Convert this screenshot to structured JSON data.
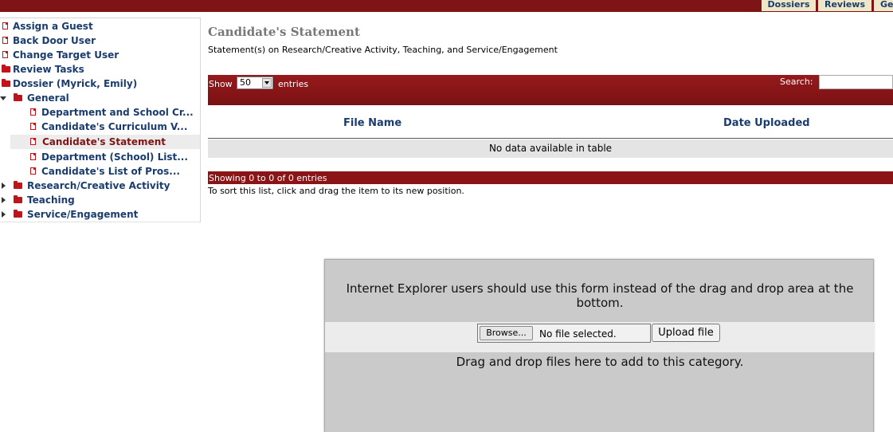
{
  "top_tabs": [
    {
      "label": "Dossiers"
    },
    {
      "label": "Reviews"
    },
    {
      "label": "Ge"
    }
  ],
  "tree": {
    "items": [
      {
        "label": "Assign a Guest"
      },
      {
        "label": "Back Door User"
      },
      {
        "label": "Change Target User"
      },
      {
        "label": "Review Tasks"
      },
      {
        "label": "Dossier (Myrick, Emily)"
      },
      {
        "label": "General"
      },
      {
        "label": "Department and School Cr..."
      },
      {
        "label": "Candidate's Curriculum V..."
      },
      {
        "label": "Candidate's Statement"
      },
      {
        "label": "Department (School) List..."
      },
      {
        "label": "Candidate's List of Pros..."
      },
      {
        "label": "Research/Creative Activity"
      },
      {
        "label": "Teaching"
      },
      {
        "label": "Service/Engagement"
      }
    ],
    "selected": "Candidate's Statement"
  },
  "main": {
    "title": "Candidate's Statement",
    "subtitle": "Statement(s) on Research/Creative Activity, Teaching, and Service/Engagement",
    "table": {
      "show_label": "Show",
      "entries_value": "50",
      "entries_label": "entries",
      "search_label": "Search:",
      "search_value": "",
      "columns": [
        "File Name",
        "Date Uploaded"
      ],
      "empty_message": "No data available in table",
      "info": "Showing 0 to 0 of 0 entries"
    },
    "sort_hint": "To sort this list, click and drag the item to its new position."
  },
  "upload": {
    "ie_message": "Internet Explorer users should use this form instead of the drag and drop area at the bottom.",
    "browse_label": "Browse...",
    "file_status": "No file selected.",
    "upload_label": "Upload file",
    "drop_message": "Drag and drop files here to add to this category."
  },
  "colors": {
    "brand": "#7f1416",
    "link": "#1a3c6e",
    "tab_bg": "#efe8c8"
  }
}
